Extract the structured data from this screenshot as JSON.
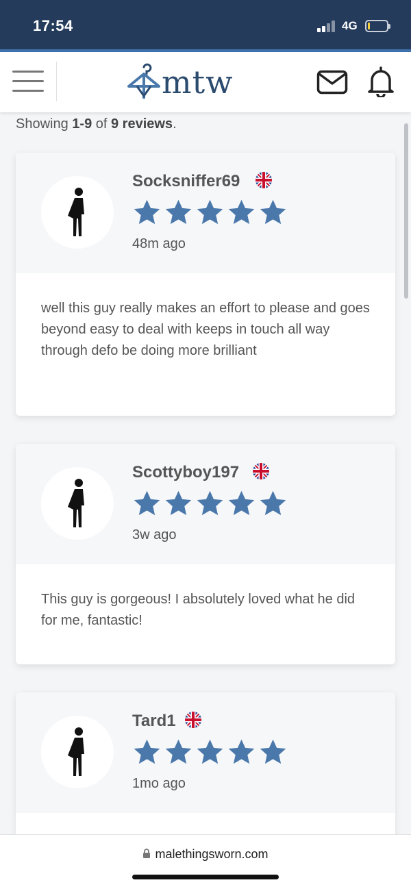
{
  "status_bar": {
    "time": "17:54",
    "network": "4G",
    "battery_level": 0.1,
    "colors": {
      "background": "#253b5b",
      "accent_line": "#3f72ad"
    }
  },
  "header": {
    "logo_text": "mtw",
    "logo_icon": "hanger-icon",
    "menu_icon": "hamburger-icon",
    "mail_icon": "mail-icon",
    "notification_icon": "bell-icon",
    "colors": {
      "logo": "#2a4a6e"
    }
  },
  "summary": {
    "prefix": "Showing ",
    "range": "1-9",
    "middle": " of ",
    "total": "9 reviews",
    "suffix": "."
  },
  "reviews": [
    {
      "name": "Socksniffer69",
      "flag": "uk-flag-icon",
      "rating": 5,
      "time_ago": "48m ago",
      "text": "well this guy really makes an effort to please and goes beyond easy to deal with keeps in touch all way through defo be doing more brilliant"
    },
    {
      "name": "Scottyboy197",
      "flag": "uk-flag-icon",
      "rating": 5,
      "time_ago": "3w ago",
      "text": "This guy is gorgeous! I absolutely loved what he did for me, fantastic!"
    },
    {
      "name": "Tard1",
      "flag": "uk-flag-icon",
      "rating": 5,
      "time_ago": "1mo ago",
      "text": ""
    }
  ],
  "star_color": "#4a78ab",
  "browser": {
    "url": "malethingsworn.com",
    "lock_icon": "lock-icon"
  }
}
